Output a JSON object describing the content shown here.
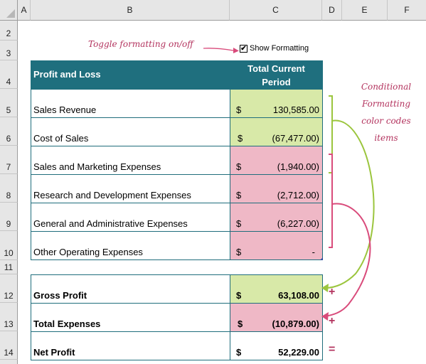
{
  "columns": [
    "A",
    "B",
    "C",
    "D",
    "E",
    "F"
  ],
  "rows": [
    "2",
    "3",
    "4",
    "5",
    "6",
    "7",
    "8",
    "9",
    "10",
    "11",
    "12",
    "13",
    "14"
  ],
  "toggle": {
    "annotation": "Toggle formatting on/off",
    "checkbox_label": "Show Formatting",
    "checked": true,
    "check_glyph": "✔"
  },
  "table": {
    "header_label": "Profit and Loss",
    "header_value_line1": "Total Current",
    "header_value_line2": "Period",
    "currency": "$",
    "items": [
      {
        "label": "Sales Revenue",
        "value": "130,585.00",
        "color": "green"
      },
      {
        "label": "Cost of Sales",
        "value": "(67,477.00)",
        "color": "green"
      },
      {
        "label": "Sales and Marketing Expenses",
        "value": "(1,940.00)",
        "color": "pink"
      },
      {
        "label": "Research and Development Expenses",
        "value": "(2,712.00)",
        "color": "pink"
      },
      {
        "label": "General and Administrative Expenses",
        "value": "(6,227.00)",
        "color": "pink"
      },
      {
        "label": "Other Operating Expenses",
        "value": "-",
        "color": "pink"
      }
    ],
    "totals": [
      {
        "label": "Gross Profit",
        "value": "63,108.00",
        "color": "green",
        "operator": "+"
      },
      {
        "label": "Total Expenses",
        "value": "(10,879.00)",
        "color": "pink",
        "operator": "+"
      },
      {
        "label": "Net Profit",
        "value": "52,229.00",
        "color": "none",
        "operator": "="
      }
    ]
  },
  "side_note": {
    "line1": "Conditional",
    "line2": "Formatting",
    "line3": "color codes",
    "line4": "items"
  },
  "colors": {
    "header_teal": "#1f6f7e",
    "positive_green": "#d8e9a8",
    "negative_pink": "#efb8c6",
    "annotation": "#b3335e",
    "bracket_green": "#9bc53d",
    "bracket_pink": "#d94b7b"
  }
}
